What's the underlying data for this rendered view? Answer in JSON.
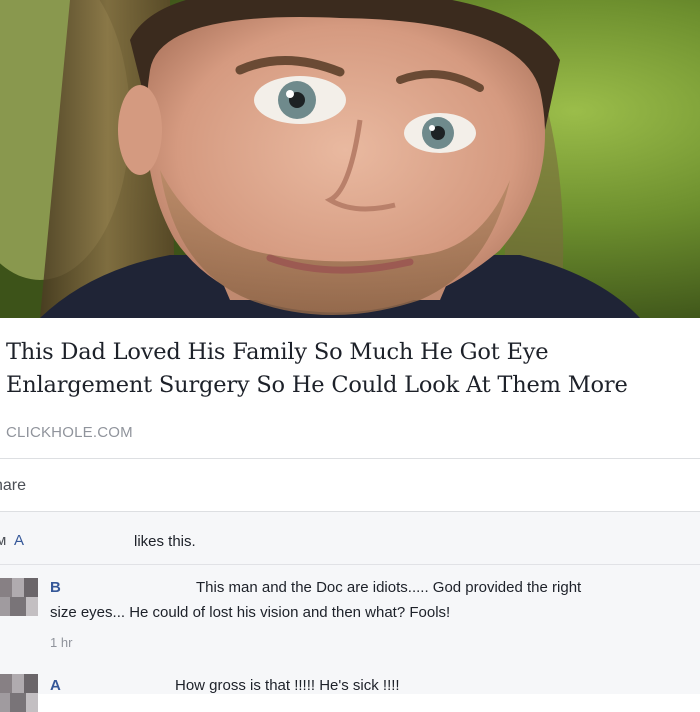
{
  "post": {
    "image_alt": "",
    "headline": "This Dad Loved His Family So Much He Got Eye Enlargement Surgery So He Could Look At Them More",
    "source": "CLICKHOLE.COM"
  },
  "share": {
    "label": "hare"
  },
  "likes": {
    "icon": "thumbs-up-icon",
    "liker": "A",
    "text": "likes this."
  },
  "comments": [
    {
      "author": "B",
      "text_line1": "This man and the Doc are idiots..... God provided the right",
      "text_line2": "size eyes... He could of lost his vision and then what? Fools!",
      "time": "1 hr"
    },
    {
      "author": "A",
      "text_line1": "How gross is that !!!!! He's sick !!!!"
    }
  ],
  "colors": {
    "link_blue": "#365899",
    "text": "#1d2129",
    "meta_gray": "#90949c",
    "comment_bg": "#f6f7f9"
  }
}
